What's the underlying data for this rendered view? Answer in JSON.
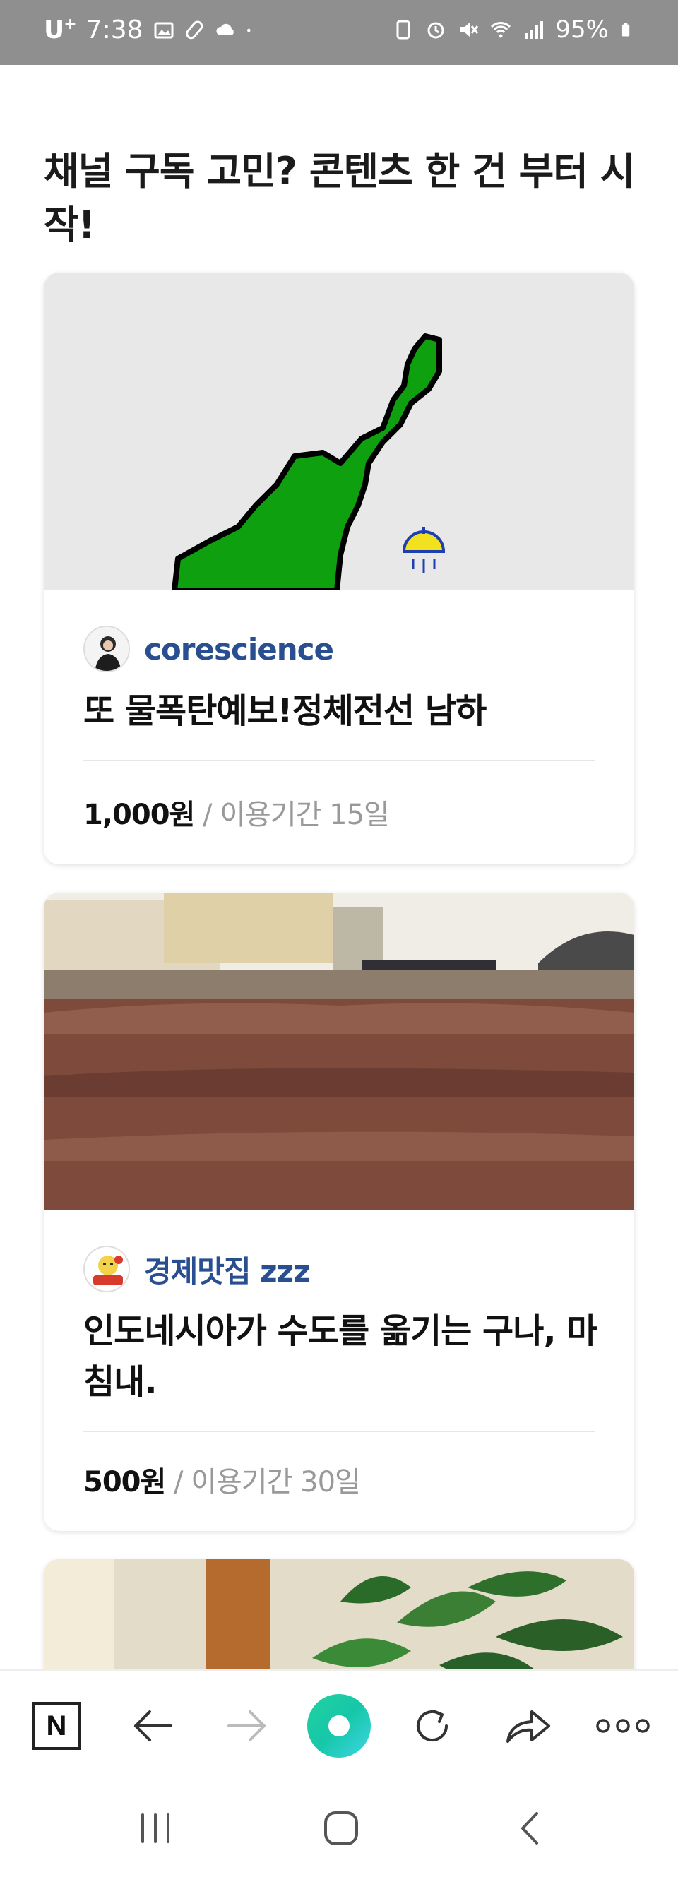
{
  "status_bar": {
    "carrier": "U",
    "carrier_sup": "+",
    "time": "7:38",
    "battery": "95%"
  },
  "headline": "채널 구독 고민? 콘텐츠 한 건 부터 시작!",
  "cards": [
    {
      "author": "corescience",
      "title": "또 물폭탄예보!정체전선 남하",
      "price": "1,000원",
      "period": " / 이용기간 15일"
    },
    {
      "author": "경제맛집 zzz",
      "title": "인도네시아가 수도를 옮기는 구나, 마침내.",
      "price": "500원",
      "period": " / 이용기간 30일"
    }
  ],
  "icons": {
    "toolbar_home": "N",
    "back": "arrow-left-icon",
    "forward": "arrow-right-icon",
    "green": "green-dot-button",
    "refresh": "refresh-icon",
    "share": "share-icon",
    "more": "more-icon"
  }
}
